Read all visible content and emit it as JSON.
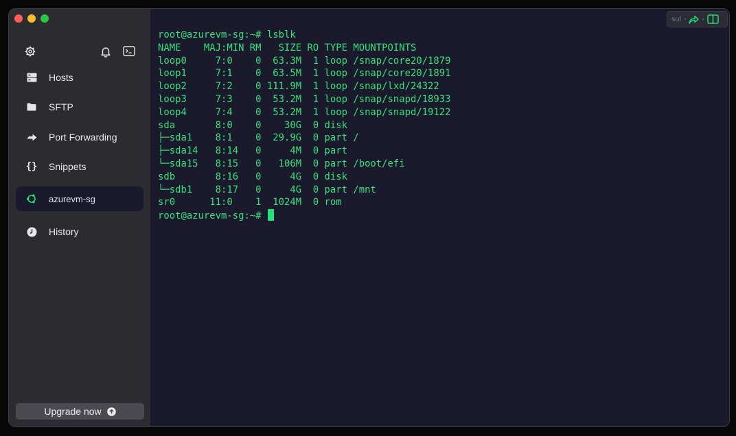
{
  "sidebar": {
    "items": [
      {
        "label": "Hosts",
        "icon": "hosts-icon"
      },
      {
        "label": "SFTP",
        "icon": "folder-icon"
      },
      {
        "label": "Port Forwarding",
        "icon": "forward-arrow-icon"
      },
      {
        "label": "Snippets",
        "icon": "braces-icon"
      },
      {
        "label": "azurevm-sg",
        "icon": "ubuntu-icon",
        "active": true
      },
      {
        "label": "History",
        "icon": "clock-icon"
      }
    ],
    "upgrade_label": "Upgrade now"
  },
  "toolbar": {
    "text": "sul",
    "sep": "•"
  },
  "terminal": {
    "lines": [
      "root@azurevm-sg:~# lsblk",
      "NAME    MAJ:MIN RM   SIZE RO TYPE MOUNTPOINTS",
      "loop0     7:0    0  63.3M  1 loop /snap/core20/1879",
      "loop1     7:1    0  63.5M  1 loop /snap/core20/1891",
      "loop2     7:2    0 111.9M  1 loop /snap/lxd/24322",
      "loop3     7:3    0  53.2M  1 loop /snap/snapd/18933",
      "loop4     7:4    0  53.2M  1 loop /snap/snapd/19122",
      "sda       8:0    0    30G  0 disk",
      "├─sda1    8:1    0  29.9G  0 part /",
      "├─sda14   8:14   0     4M  0 part",
      "└─sda15   8:15   0   106M  0 part /boot/efi",
      "sdb       8:16   0     4G  0 disk",
      "└─sdb1    8:17   0     4G  0 part /mnt",
      "sr0      11:0    1  1024M  0 rom"
    ],
    "prompt": "root@azurevm-sg:~# "
  },
  "colors": {
    "terminal_bg": "#1a1a2c",
    "terminal_fg": "#37e07a",
    "sidebar_bg": "#2c2c30",
    "accent": "#22e07a"
  }
}
